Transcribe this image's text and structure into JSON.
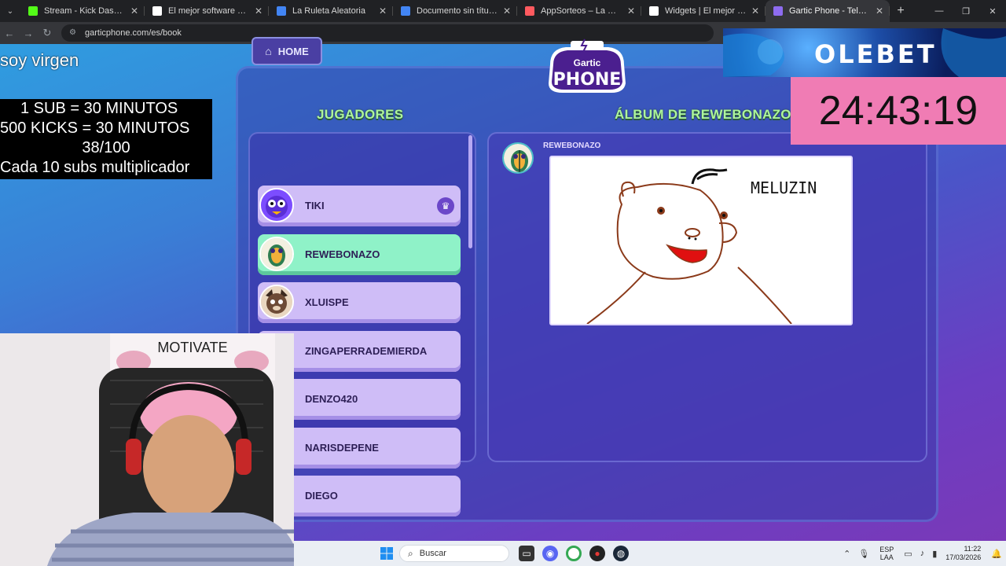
{
  "browser": {
    "tabs": [
      {
        "title": "Stream - Kick Dashboard",
        "favicon_color": "#53fc18"
      },
      {
        "title": "El mejor software para pote",
        "favicon_color": "#ffffff"
      },
      {
        "title": "La Ruleta Aleatoria",
        "favicon_color": "#4285f4"
      },
      {
        "title": "Documento sin título - Docum",
        "favicon_color": "#4285f4"
      },
      {
        "title": "AppSorteos – La Ruleta de la S",
        "favicon_color": "#ff5a5f"
      },
      {
        "title": "Widgets | El mejor software pa",
        "favicon_color": "#ffffff"
      },
      {
        "title": "Gartic Phone - Teléfono De",
        "favicon_color": "#8e6cf0"
      }
    ],
    "active_tab": 6,
    "url": "garticphone.com/es/book"
  },
  "game": {
    "home_label": "HOME",
    "logo_top": "Gartic",
    "logo_bottom": "PHONE",
    "players_title": "JUGADORES",
    "album_title": "ÁLBUM DE REWEBONAZO",
    "players": [
      {
        "name": "TIKI",
        "host": true,
        "current": false
      },
      {
        "name": "REWEBONAZO",
        "host": false,
        "current": true
      },
      {
        "name": "XLUISPE",
        "host": false,
        "current": false
      },
      {
        "name": "ZINGAPERRADEMIERDA",
        "host": false,
        "current": false
      },
      {
        "name": "DENZO420",
        "host": false,
        "current": false
      },
      {
        "name": "NARISDEPENE",
        "host": false,
        "current": false
      },
      {
        "name": "DIEGO",
        "host": false,
        "current": false
      }
    ],
    "album_author": "REWEBONAZO",
    "drawing_caption": "MELUZIN"
  },
  "overlay": {
    "status_text": "soy virgen",
    "rules": [
      "1 SUB     = 30 MINUTOS",
      "500 KICKS = 30 MINUTOS",
      "38/100",
      "Cada 10 subs multiplicador"
    ],
    "sponsor": "OLEBET",
    "timer": "24:43:19",
    "webcam_sign": "MOTIVATE"
  },
  "taskbar": {
    "search_placeholder": "Buscar",
    "lang_top": "ESP",
    "lang_bottom": "LAA",
    "time": "11:22",
    "date": "17/03/2026"
  },
  "colors": {
    "accent_green": "#aef59c",
    "player_card": "#cfbdf7",
    "player_card_active": "#8ff2c8",
    "timer_bg": "#f07cb4"
  }
}
